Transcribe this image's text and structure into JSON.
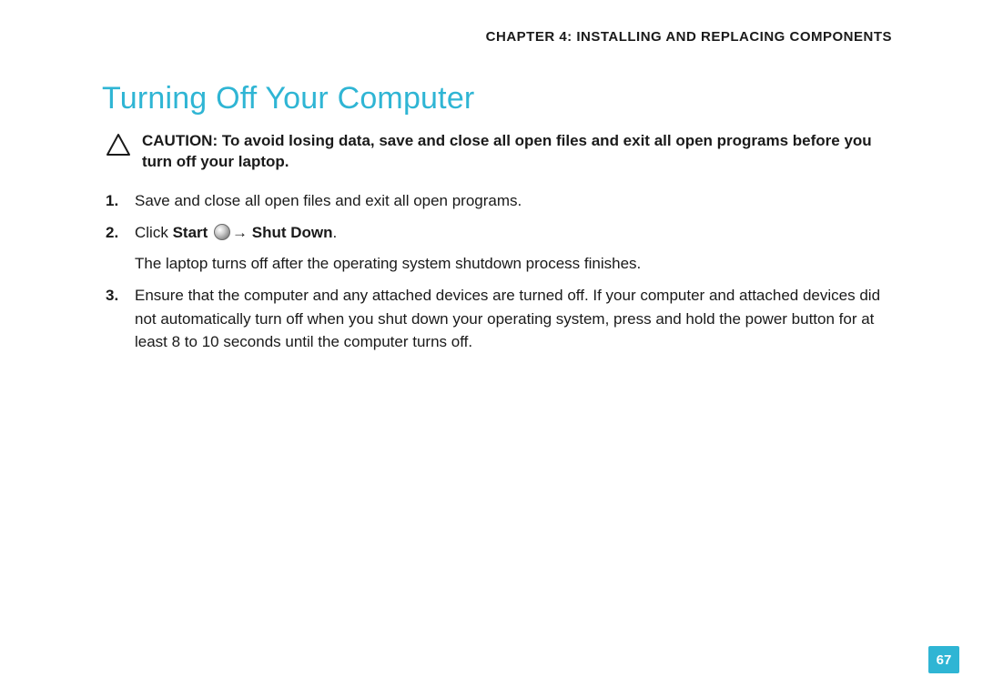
{
  "header": {
    "chapter": "CHAPTER 4: INSTALLING AND REPLACING COMPONENTS"
  },
  "section": {
    "title": "Turning Off Your Computer"
  },
  "caution": {
    "text": "CAUTION: To avoid losing data, save and close all open files and exit all open programs before you turn off your laptop."
  },
  "steps": {
    "s1": "Save and close all open files and exit all open programs.",
    "s2_prefix": "Click ",
    "s2_start": "Start",
    "s2_arrow": "→ ",
    "s2_shutdown": "Shut Down",
    "s2_suffix": ".",
    "s2_sub": "The laptop turns off after the operating system shutdown process finishes.",
    "s3": "Ensure that the computer and any attached devices are turned off. If your computer and attached devices did not automatically turn off when you shut down your operating system, press and hold the power button for at least 8 to 10 seconds until the computer turns off."
  },
  "page": {
    "number": "67"
  },
  "colors": {
    "accent": "#2fb5d4"
  }
}
